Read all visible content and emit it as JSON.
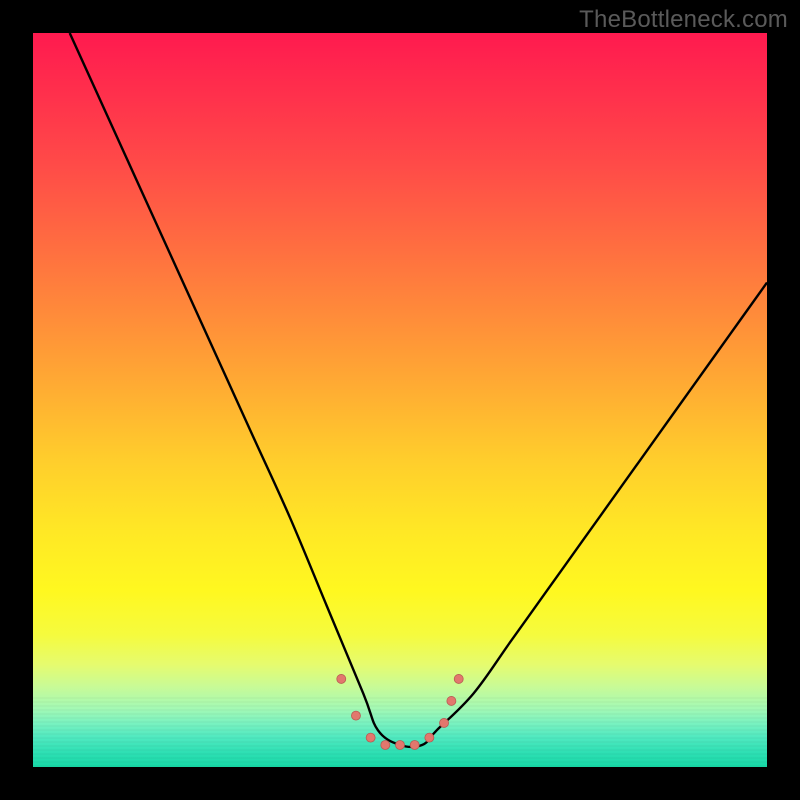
{
  "attribution": "TheBottleneck.com",
  "chart_data": {
    "type": "line",
    "title": "",
    "xlabel": "",
    "ylabel": "",
    "xlim": [
      0,
      100
    ],
    "ylim": [
      0,
      100
    ],
    "grid": false,
    "legend": false,
    "background": {
      "description": "Vertical gradient from red (top) through orange/yellow to green (bottom) representing bottleneck severity",
      "top_color": "#ff1a4f",
      "mid_color": "#ffe825",
      "bottom_color": "#17d9a7"
    },
    "series": [
      {
        "name": "bottleneck-curve",
        "description": "V-shaped performance match curve; minimum (best match) near x≈50, rising steeply on the left branch and moderately on the right branch.",
        "x": [
          5,
          10,
          15,
          20,
          25,
          30,
          35,
          40,
          45,
          47,
          50,
          53,
          55,
          60,
          65,
          70,
          75,
          80,
          85,
          90,
          95,
          100
        ],
        "y": [
          100,
          89,
          78,
          67,
          56,
          45,
          34,
          22,
          10,
          5,
          3,
          3,
          5,
          10,
          17,
          24,
          31,
          38,
          45,
          52,
          59,
          66
        ]
      },
      {
        "name": "minimum-dots",
        "type": "scatter",
        "description": "Small coral markers clustered around the curve minimum",
        "x": [
          42,
          44,
          46,
          48,
          50,
          52,
          54,
          56,
          57,
          58
        ],
        "y": [
          12,
          7,
          4,
          3,
          3,
          3,
          4,
          6,
          9,
          12
        ],
        "color": "#e2776d",
        "size": 9
      }
    ]
  }
}
